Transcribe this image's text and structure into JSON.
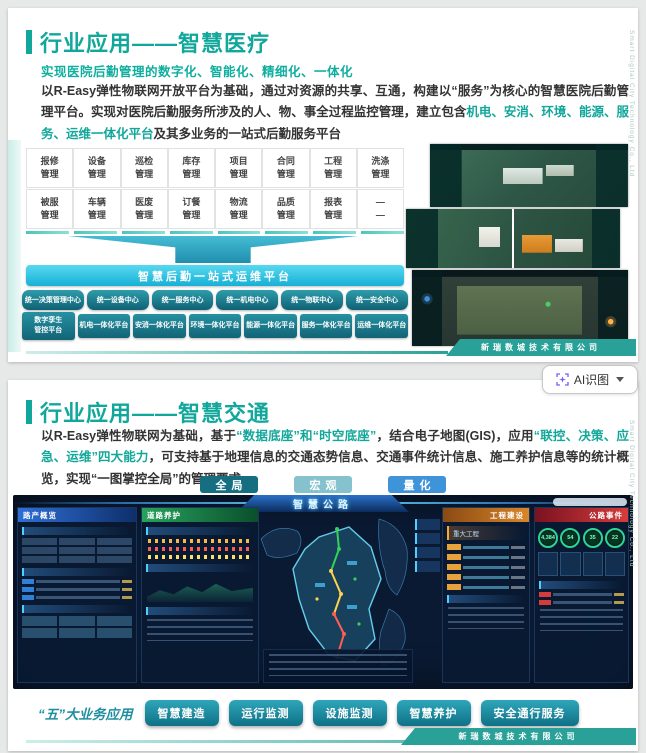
{
  "viewer": {
    "background": "#e7e8e8",
    "ai_button": {
      "label": "AI识图"
    }
  },
  "company": {
    "footer": "新瑞数城技术有限公司",
    "side_text": "Smart Digital City Technology Co., Ltd"
  },
  "colors": {
    "accent_teal": "#12a79b",
    "banner_cyan": "#17b0d6",
    "ribbon_teal": "#2aa198"
  },
  "slide1": {
    "title": "行业应用——智慧医疗",
    "subtitle": "实现医院后勤管理的数字化、智能化、精细化、一体化",
    "body": [
      {
        "t": "以R-Easy弹性物联网开放平台为基础，通过对资源的共享、互通，构建以“服务”为核心的智慧医院后勤管理平台。实现对医院后勤服务所涉及的人、物、事全过程监控管理，建立包含"
      },
      {
        "t": "机电、安消、环境、能源、服务、运维一体化平台",
        "c": "#12a79b"
      },
      {
        "t": "及其多业务的一站式后勤服务平台"
      }
    ],
    "grid_row1": [
      "报修\n管理",
      "设备\n管理",
      "巡检\n管理",
      "库存\n管理",
      "项目\n管理",
      "合同\n管理",
      "工程\n管理",
      "洗涤\n管理"
    ],
    "grid_row2": [
      "被服\n管理",
      "车辆\n管理",
      "医废\n管理",
      "订餐\n管理",
      "物流\n管理",
      "品质\n管理",
      "报表\n管理",
      "—\n—"
    ],
    "banner": "智慧后勤一站式运维平台",
    "centers": [
      "统一决策管理中心",
      "统一设备中心",
      "统一服务中心",
      "统一机电中心",
      "统一物联中心",
      "统一安全中心"
    ],
    "platforms": [
      "数字孪生\n管控平台",
      "机电一体化平台",
      "安消一体化平台",
      "环境一体化平台",
      "能源一体化平台",
      "服务一体化平台",
      "运维一体化平台"
    ]
  },
  "slide2": {
    "title": "行业应用——智慧交通",
    "body": [
      {
        "t": "以R-Easy弹性物联网为基础，基于"
      },
      {
        "t": "“数据底座”和“时空底座”",
        "c": "#12a79b"
      },
      {
        "t": "，结合电子地图(GIS)，应用"
      },
      {
        "t": "“联控、决策、应急、运维”四大能力",
        "c": "#12a79b"
      },
      {
        "t": "，可支持基于地理信息的交通态势信息、交通事件统计信息、施工养护信息等的统计概览，实现“一图掌控全局”的管理要求。"
      }
    ],
    "modes": [
      {
        "text": "全局",
        "bg": "#156f81"
      },
      {
        "text": "宏观",
        "bg": "#85c2cd"
      },
      {
        "text": "量化",
        "bg": "#3f93d8"
      }
    ],
    "dashboard": {
      "title": "智慧公路",
      "panel_assets": "路产概览",
      "panel_maintenance": "道路养护",
      "panel_construction": "工程建设",
      "panel_events": "公路事件",
      "section_major_projects": "重大工程",
      "gauge_values": [
        "4,384",
        "54",
        "35",
        "22"
      ]
    },
    "biz_label": "“五”大业务应用",
    "biz_buttons": [
      "智慧建造",
      "运行监测",
      "设施监测",
      "智慧养护",
      "安全通行服务"
    ]
  }
}
